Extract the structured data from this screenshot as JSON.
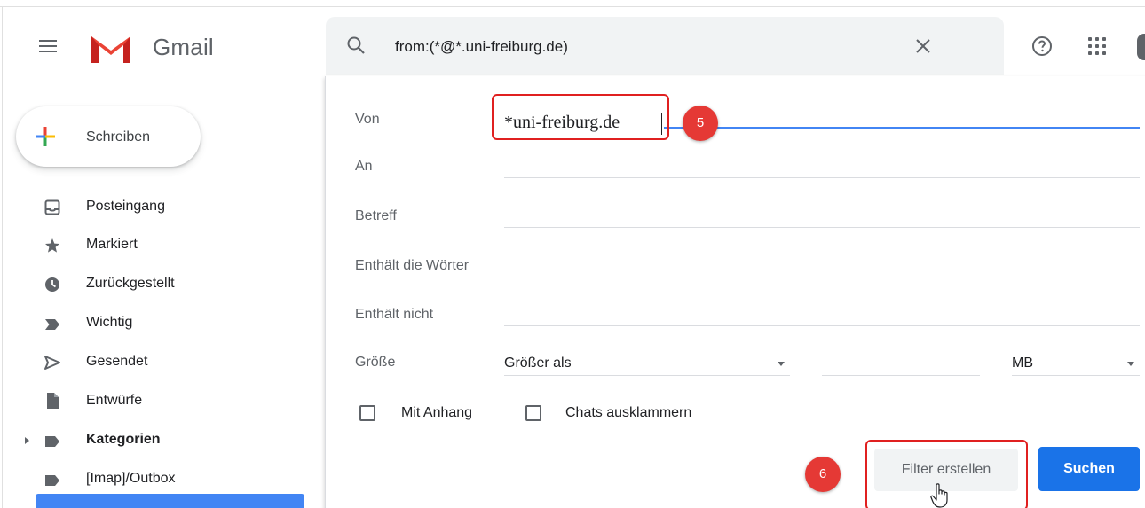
{
  "app": {
    "title": "Gmail"
  },
  "search": {
    "query": "from:(*@*.uni-freiburg.de)"
  },
  "sidebar": {
    "compose_label": "Schreiben",
    "items": [
      {
        "label": "Posteingang",
        "icon": "inbox-icon"
      },
      {
        "label": "Markiert",
        "icon": "star-icon"
      },
      {
        "label": "Zurückgestellt",
        "icon": "clock-icon"
      },
      {
        "label": "Wichtig",
        "icon": "important-icon"
      },
      {
        "label": "Gesendet",
        "icon": "send-icon"
      },
      {
        "label": "Entwürfe",
        "icon": "draft-icon"
      },
      {
        "label": "Kategorien",
        "icon": "label-icon"
      },
      {
        "label": "[Imap]/Outbox",
        "icon": "label-icon"
      }
    ]
  },
  "advanced_search": {
    "from_label": "Von",
    "from_value": "*uni-freiburg.de",
    "to_label": "An",
    "subject_label": "Betreff",
    "has_words_label": "Enthält die Wörter",
    "not_has_label": "Enthält nicht",
    "size_label": "Größe",
    "size_operator": "Größer als",
    "size_unit": "MB",
    "has_attachment_label": "Mit Anhang",
    "exclude_chats_label": "Chats ausklammern",
    "create_filter_label": "Filter erstellen",
    "search_button_label": "Suchen"
  },
  "annotations": {
    "step_a": "5",
    "step_b": "6"
  },
  "colors": {
    "accent": "#1a73e8",
    "annotation": "#e53935",
    "gmail_red": "#ea4335"
  }
}
